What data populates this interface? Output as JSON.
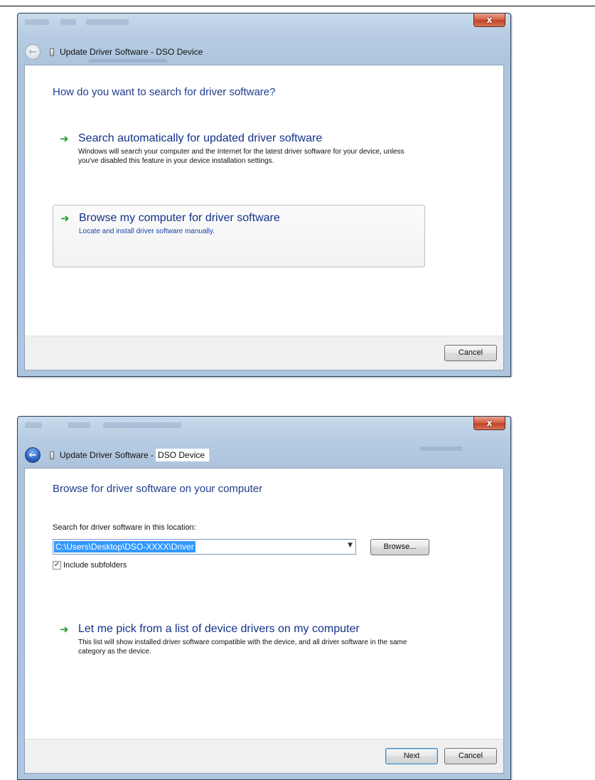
{
  "dialog1": {
    "close_label": "x",
    "title": "Update Driver Software - DSO Device",
    "heading": "How do you want to search for driver software?",
    "options": [
      {
        "title": "Search automatically for updated driver software",
        "description": "Windows will search your computer and the Internet for the latest driver software for your device, unless you've disabled this feature in your device installation settings."
      },
      {
        "title": "Browse my computer for driver software",
        "description": "Locate and install driver software manually."
      }
    ],
    "cancel_label": "Cancel"
  },
  "dialog2": {
    "close_label": "x",
    "title_prefix": "Update Driver Software -",
    "title_device": "DSO Device",
    "heading": "Browse for driver software on your computer",
    "search_label": "Search for driver software in this location:",
    "path_value": "C:\\Users\\Desktop\\DSO-XXXX\\Driver",
    "browse_label": "Browse...",
    "include_subfolders_label": "Include subfolders",
    "include_subfolders_checked": true,
    "pick_option": {
      "title": "Let me pick from a list of device drivers on my computer",
      "description": "This list will show installed driver software compatible with the device, and all driver software in the same category as the device."
    },
    "next_label": "Next",
    "cancel_label": "Cancel"
  },
  "icons": {
    "arrow": "green-right-arrow",
    "back": "back-arrow",
    "device": "usb-device"
  },
  "colors": {
    "heading": "#1f3c8c",
    "link": "#13328a",
    "arrow": "#1f9d2b",
    "close": "#c24326",
    "selection": "#3399ff"
  }
}
